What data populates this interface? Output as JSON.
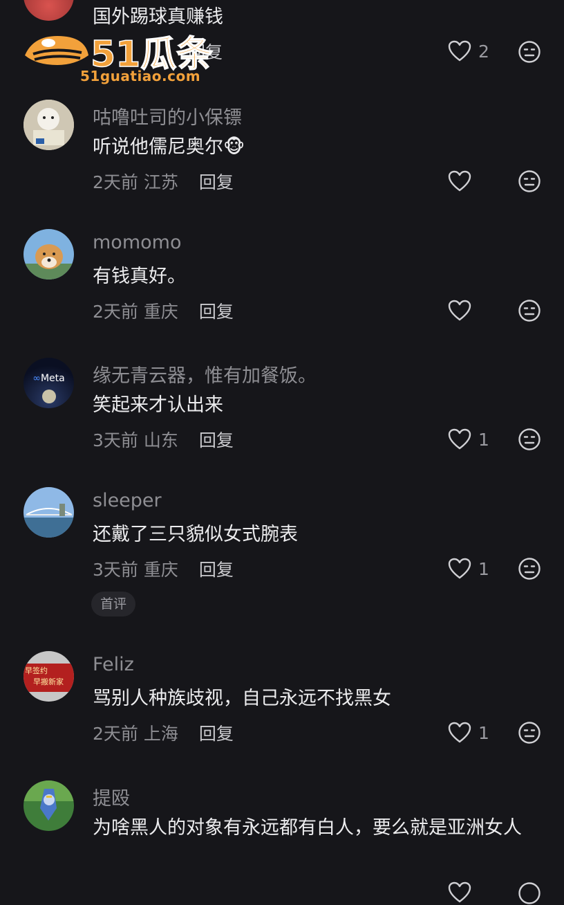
{
  "comments": [
    {
      "username": "",
      "text": "国外踢球真赚钱",
      "time": "",
      "location": "",
      "reply_label": "回复",
      "likes": "2"
    },
    {
      "username": "咕噜吐司的小保镖",
      "text": "听说他儒尼奥尔",
      "emoji": "🐵",
      "time": "2天前",
      "location": "江苏",
      "reply_label": "回复",
      "likes": ""
    },
    {
      "username": "momomo",
      "text": "有钱真好。",
      "time": "2天前",
      "location": "重庆",
      "reply_label": "回复",
      "likes": ""
    },
    {
      "username": "缘无青云器，惟有加餐饭。",
      "text": "笑起来才认出来",
      "avatar_text": "Meta",
      "time": "3天前",
      "location": "山东",
      "reply_label": "回复",
      "likes": "1"
    },
    {
      "username": "sleeper",
      "text": "还戴了三只貌似女式腕表",
      "time": "3天前",
      "location": "重庆",
      "reply_label": "回复",
      "likes": "1",
      "tag": "首评"
    },
    {
      "username": "Feliz",
      "text": "骂别人种族歧视，自己永远不找黑女",
      "avatar_text_1": "早签约",
      "avatar_text_2": "早搬新家",
      "time": "2天前",
      "location": "上海",
      "reply_label": "回复",
      "likes": "1"
    },
    {
      "username": "提殴",
      "text": "为啥黑人的对象有永远都有白人，要么就是亚洲女人",
      "time": "",
      "location": "",
      "reply_label": "",
      "likes": ""
    }
  ],
  "watermark": {
    "logo_text": "51瓜条",
    "url": "51guatiao.com"
  },
  "colors": {
    "background": "#16161a",
    "username": "#8e8e93",
    "text": "#ececee",
    "watermark_orange": "#f2a13b"
  }
}
